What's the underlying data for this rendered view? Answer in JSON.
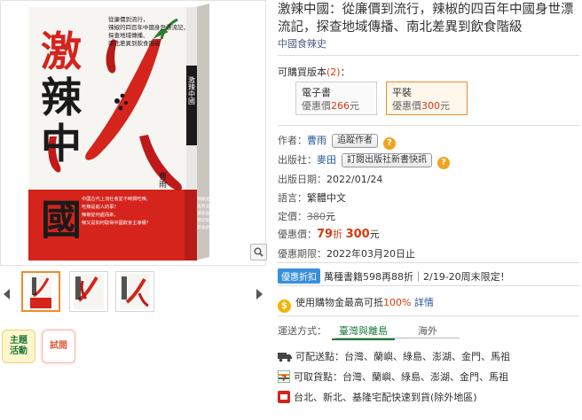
{
  "book": {
    "title": "激辣中國：從廉價到流行，辣椒的四百年中國身世漂流記，探查地域傳播、南北差異到飲食階級",
    "series": "中國食辣史",
    "cover": {
      "big_title_chars": [
        "激",
        "辣",
        "中",
        "國"
      ],
      "subtitle_lines": [
        "從廉價到流行，",
        "辣椒的四百年中國身世漂流記，",
        "探查地域傳播、",
        "南北差異到飲食階級"
      ],
      "author": "曹雨",
      "spine_title": "激辣中國",
      "blurb_lines": [
        "中國古代上流社會並不時興吃辣，",
        "吃辣是窮人的事？",
        "辣椒從何處而來，",
        "辣又是如何取得中國飲食主導權？"
      ],
      "blurb_right_lines": [
        "辣椒從引種到",
        "成為全民熱愛的",
        "調味品，辣的",
        "歷史就是中國",
        "飲食史"
      ],
      "colors": {
        "red": "#d4241c",
        "black": "#1a1a1a",
        "paper": "#f7f6f3"
      }
    }
  },
  "versions": {
    "label": "可購買版本",
    "count": "(2)",
    "suffix": "：",
    "items": [
      {
        "name": "電子書",
        "price_label": "優惠價",
        "price": "266",
        "unit": "元",
        "selected": false
      },
      {
        "name": "平裝",
        "price_label": "優惠價",
        "price": "300",
        "unit": "元",
        "selected": true
      }
    ]
  },
  "details": {
    "author_label": "作者：",
    "author": "曹雨",
    "author_btn": "追蹤作者",
    "publisher_label": "出版社：",
    "publisher": "麥田",
    "publisher_btn": "訂閱出版社新書快訊",
    "date_label": "出版日期：",
    "date": "2022/01/24",
    "lang_label": "語言：",
    "lang": "繁體中文",
    "list_price_label": "定價：",
    "list_price": "380",
    "unit": "元",
    "sale_label": "優惠價：",
    "sale_discount": "79",
    "sale_discount_unit": "折",
    "sale_price": "300",
    "expiry_label": "優惠期限：",
    "expiry": "2022年03月20日止"
  },
  "promo": {
    "tag": "優惠折扣",
    "text": "萬種書籍598再88折｜2/19-20周末限定！"
  },
  "coupon": {
    "coin_glyph": "$",
    "text_before": "使用購物金最高可抵",
    "percent": "100%",
    "text_after": " 詳情"
  },
  "shipping": {
    "label": "運送方式：",
    "tabs": [
      "臺灣與離島",
      "海外"
    ],
    "rows": [
      {
        "icon": "truck-icon",
        "text": "可配送點：台灣、蘭嶼、綠島、澎湖、金門、馬祖"
      },
      {
        "icon": "seven-eleven-icon",
        "text": "可取貨點：台灣、蘭嶼、綠島、澎湖、金門、馬祖"
      },
      {
        "icon": "family-mart-icon",
        "text": "台北、新北、基隆宅配快速到貨(除外地區)"
      }
    ]
  },
  "left": {
    "promo_pill": "主題活動",
    "promo_pill_lines": [
      "主題",
      "活動"
    ],
    "trial_pill": "試閱"
  }
}
